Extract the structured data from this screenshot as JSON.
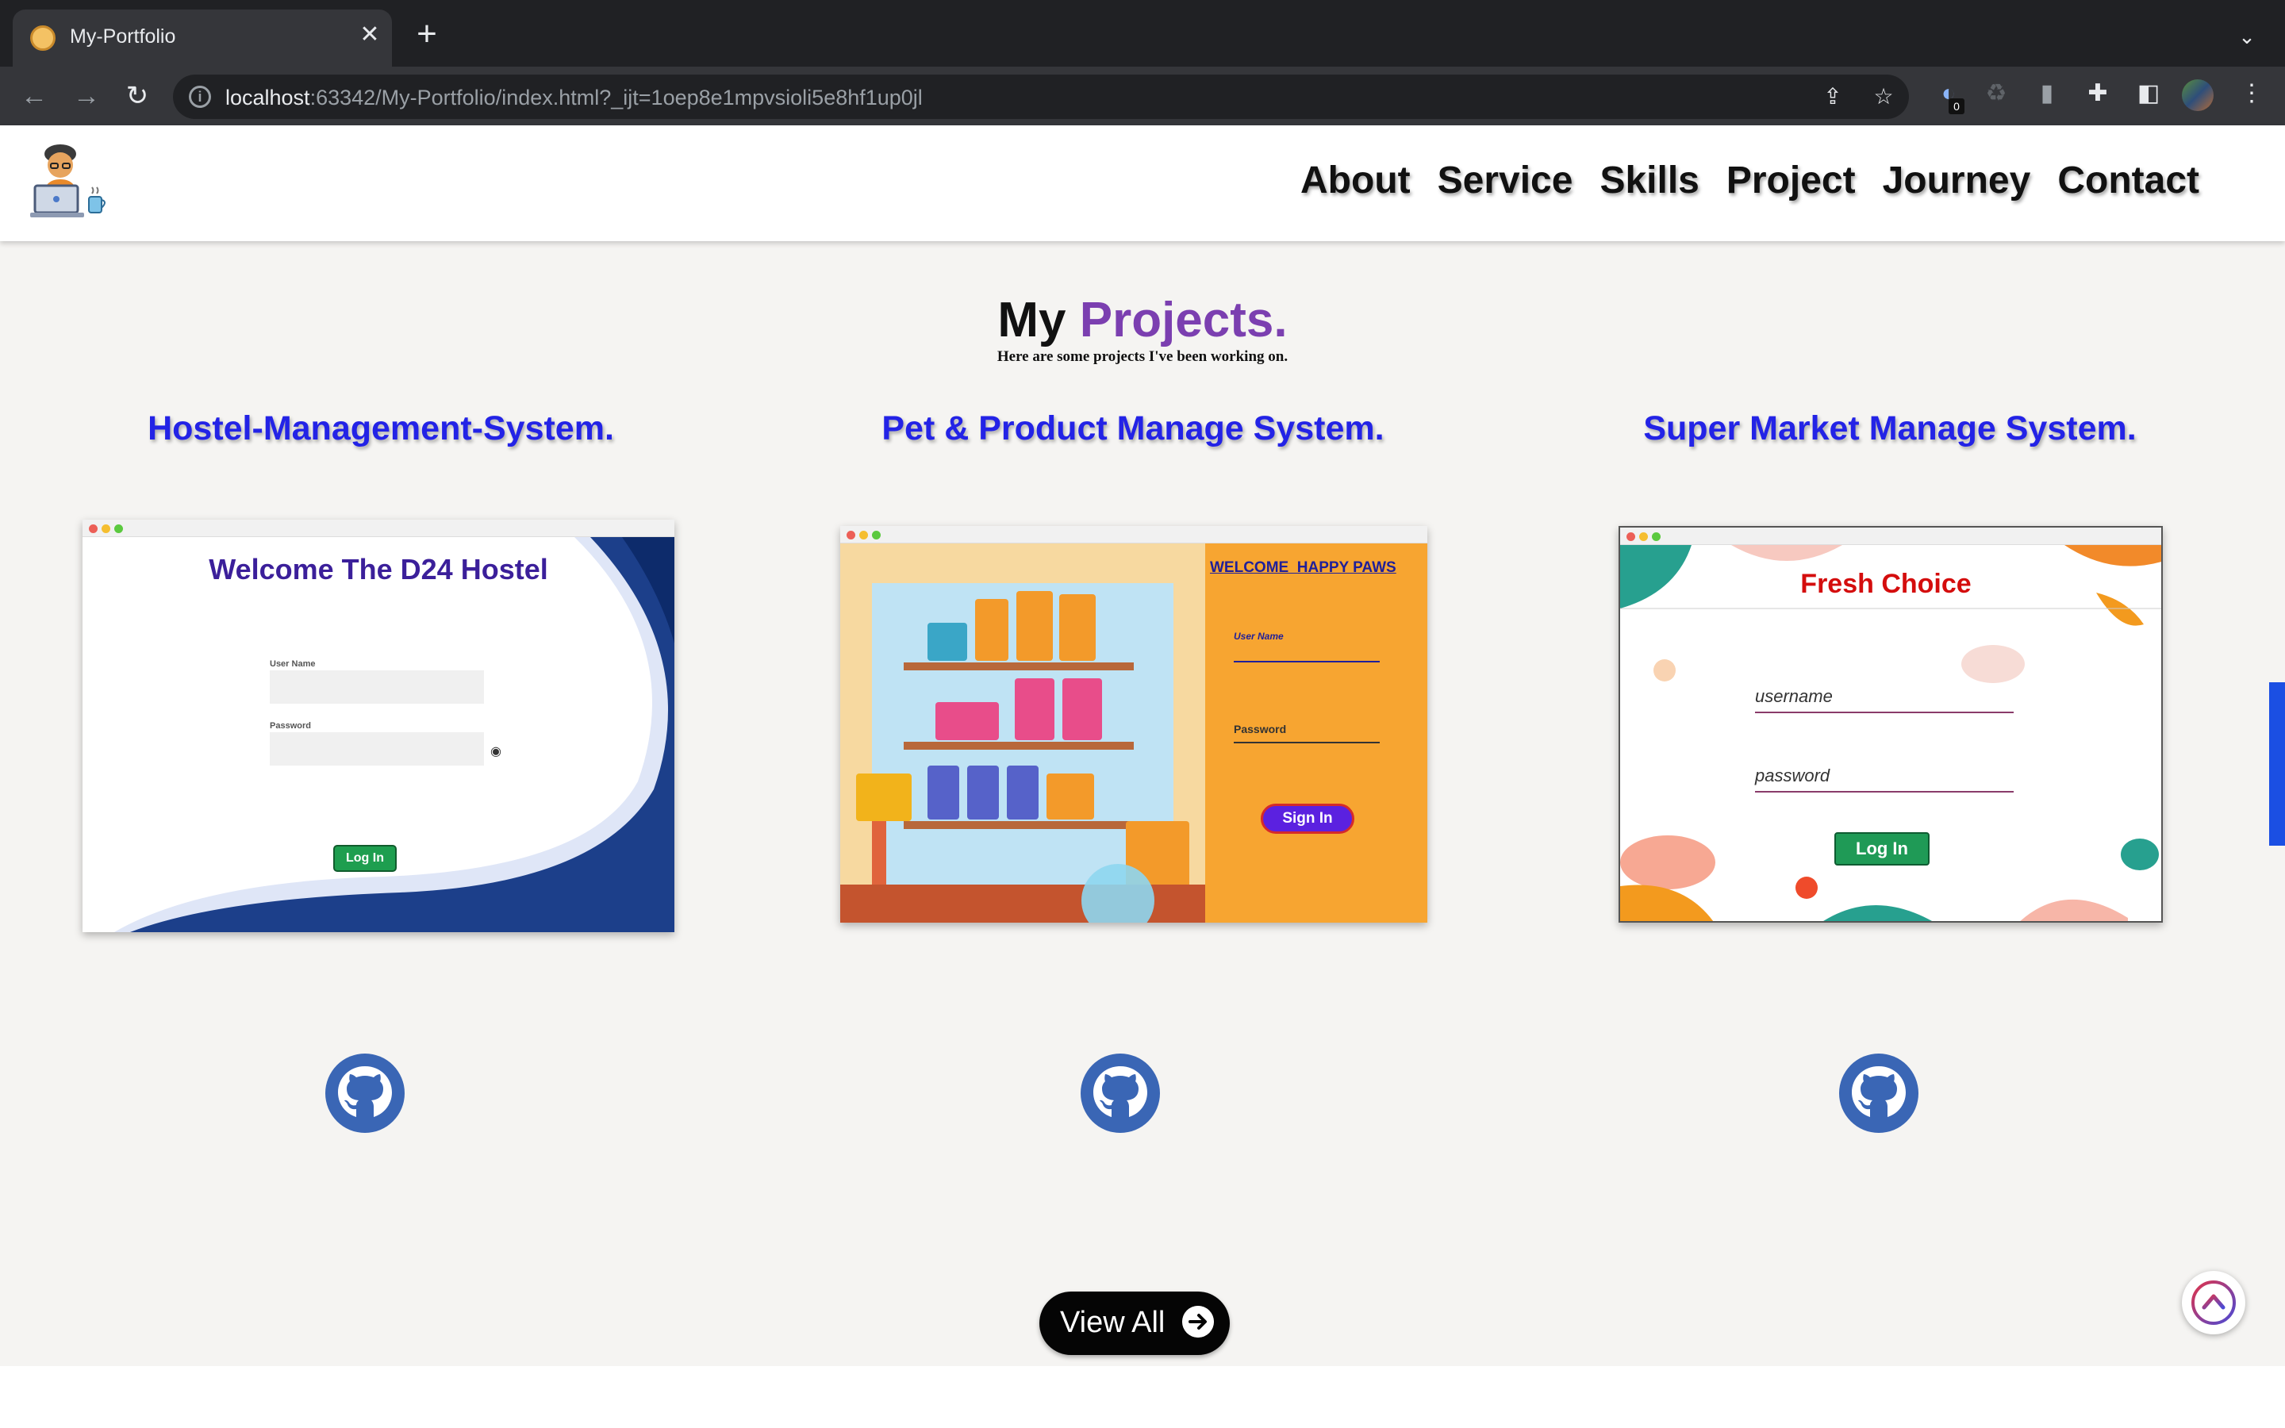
{
  "browser": {
    "tab_title": "My-Portfolio",
    "tab_close": "✕",
    "new_tab": "+",
    "url_host": "localhost",
    "url_rest": ":63342/My-Portfolio/index.html?_ijt=1oep8e1mpvsioli5e8hf1up0jl",
    "extension_badge": "0"
  },
  "header": {
    "nav": [
      "About",
      "Service",
      "Skills",
      "Project",
      "Journey",
      "Contact"
    ]
  },
  "section": {
    "title_main": "My ",
    "title_accent": "Projects.",
    "subtitle": "Here are some projects I've been working on."
  },
  "projects": [
    {
      "title": "Hostel-Management-System.",
      "preview": {
        "heading": "Welcome The D24 Hostel",
        "user_label": "User Name",
        "pass_label": "Password",
        "button": "Log In"
      }
    },
    {
      "title": "Pet & Product Manage System.",
      "preview": {
        "heading": "WELCOME  HAPPY PAWS",
        "user_label": "User Name",
        "pass_label": "Password",
        "button": "Sign In"
      }
    },
    {
      "title": "Super Market Manage System.",
      "preview": {
        "heading": "Fresh Choice",
        "user_label": "username",
        "pass_label": "password",
        "button": "Log In"
      }
    }
  ],
  "view_all": "View All",
  "colors": {
    "accent_purple": "#7b3fb0",
    "project_title_blue": "#2323e6",
    "github_blue": "#3a66b5",
    "scroll_indicator": "#1b4fe3"
  },
  "icons": {
    "github": "github-icon",
    "back_to_top": "chevron-up-icon",
    "view_all_arrow": "arrow-right-icon"
  }
}
